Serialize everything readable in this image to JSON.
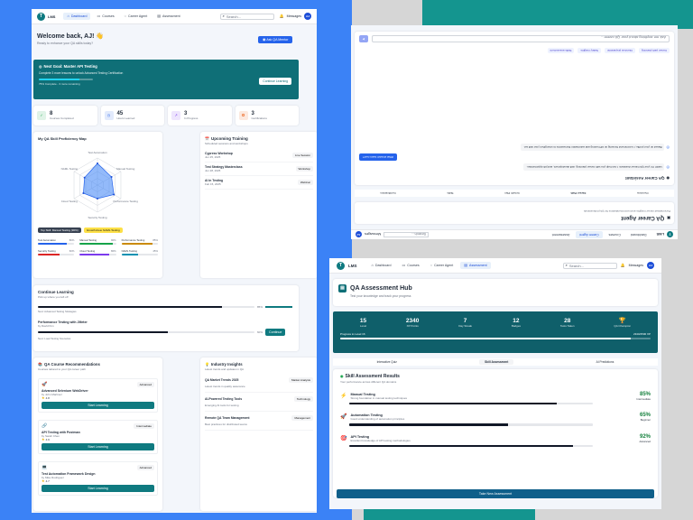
{
  "brand": {
    "name": "LMS",
    "logo": "T"
  },
  "nav": {
    "dashboard": "Dashboard",
    "courses": "Courses",
    "career_agent": "Career Agent",
    "assessment": "Assessment",
    "search_placeholder": "Search...",
    "messages": "Messages",
    "avatar": "AJ"
  },
  "dashboard": {
    "welcome": "Welcome back, AJ! 👋",
    "subtitle": "Ready to enhance your QA skills today?",
    "ask_button": "Ask QA Mentor",
    "banner": {
      "title": "Next Goal: Master API Testing",
      "desc": "Complete 3 more lessons to unlock Advanced Testing Certification",
      "progress_text": "75% Complete - 3 more remaining",
      "progress": 0.75,
      "button": "Continue Learning"
    },
    "stats": [
      {
        "value": "8",
        "label": "Courses Completed",
        "icon": "check-icon",
        "color": "#16a34a"
      },
      {
        "value": "45",
        "label": "Hours Learned",
        "icon": "clock-icon",
        "color": "#2563eb"
      },
      {
        "value": "3",
        "label": "In Progress",
        "icon": "trend-icon",
        "color": "#7c3aed"
      },
      {
        "value": "3",
        "label": "Certifications",
        "icon": "award-icon",
        "color": "#ea580c"
      }
    ],
    "proficiency": {
      "title": "My QA Skill Proficiency Map",
      "axes": [
        "Test Automation",
        "Manual Testing",
        "Performance Testing",
        "Security Testing",
        "Cloud Testing",
        "NAML Testing"
      ],
      "values": [
        0.8,
        0.6,
        0.7,
        0.5,
        0.6,
        0.55
      ],
      "top_skill": "Top Skill: Manual Testing (90%)",
      "growth": "Growth Area: NAML Testing",
      "skills": [
        {
          "name": "Test Automation",
          "value": "80%",
          "p": 0.8,
          "color": "#2563eb"
        },
        {
          "name": "Manual Testing",
          "value": "90%",
          "p": 0.9,
          "color": "#16a34a"
        },
        {
          "name": "Performance Testing",
          "value": "85%",
          "p": 0.85,
          "color": "#ca8a04"
        },
        {
          "name": "Security Testing",
          "value": "60%",
          "p": 0.6,
          "color": "#dc2626"
        },
        {
          "name": "Cloud Testing",
          "value": "80%",
          "p": 0.8,
          "color": "#7c3aed"
        },
        {
          "name": "NAML Testing",
          "value": "45%",
          "p": 0.45,
          "color": "#0891b2"
        }
      ]
    },
    "training": {
      "title": "Upcoming Training",
      "subtitle": "Scheduled sessions and workshops",
      "items": [
        {
          "name": "Cypress Workshop",
          "date": "Jun 25, 2025",
          "tag": "Live Session"
        },
        {
          "name": "Test Strategy Masterclass",
          "date": "Jun 28, 2025",
          "tag": "Workshop"
        },
        {
          "name": "AI in Testing",
          "date": "Feb 15, 2025",
          "tag": "Webinar"
        }
      ]
    },
    "continue": {
      "title": "Continue Learning",
      "subtitle": "Pick up where you left off",
      "items": [
        {
          "name": "",
          "meta": "Next: Advanced Testing Strategies",
          "pct": "85%",
          "p": 0.85,
          "button": ""
        },
        {
          "name": "Performance Testing with JMeter",
          "author": "by David Kim",
          "meta": "Next: Load Testing Scenarios",
          "pct": "60%",
          "p": 0.6,
          "button": "Continue"
        }
      ]
    },
    "recs": {
      "title": "QA Course Recommendations",
      "subtitle": "Courses tailored to your QA career path",
      "items": [
        {
          "icon": "rocket-icon",
          "name": "Advanced Selenium WebDriver",
          "author": "by John Martinez",
          "rating": "4.8",
          "level": "Advanced",
          "button": "Start Learning"
        },
        {
          "icon": "link-icon",
          "name": "API Testing with Postman",
          "author": "by Sarah Chen",
          "rating": "4.9",
          "level": "Intermediate",
          "button": "Start Learning"
        },
        {
          "icon": "laptop-icon",
          "name": "Test Automation Framework Design",
          "author": "by Mike Rodriguez",
          "rating": "4.7",
          "level": "Advanced",
          "button": "Start Learning"
        }
      ]
    },
    "insights": {
      "title": "Industry Insights",
      "subtitle": "Latest trends and updates in QA",
      "items": [
        {
          "name": "QA Market Trends 2025",
          "desc": "Latest trends in quality assurance",
          "tag": "Market Analysis"
        },
        {
          "name": "AI-Powered Testing Tools",
          "desc": "Emerging AI tools for testing",
          "tag": "Technology"
        },
        {
          "name": "Remote QA Team Management",
          "desc": "Best practices for distributed teams",
          "tag": "Management"
        }
      ]
    }
  },
  "career": {
    "title": "QA Career Agent",
    "subtitle": "Personalized career insights and recommendations for QA professionals",
    "tabs": [
      "Overview",
      "Career Path",
      "Growth Plan",
      "Skills",
      "Certifications"
    ],
    "assistant_title": "QA Career Assistant",
    "msg_bot1": "Hello! I'm your QA Career Assistant. I can help you with career planning, skill development, and job opportunities.",
    "msg_user": "What should I learn next?",
    "msg_bot2": "Based on your profile, I recommend focusing on API testing and automation frameworks to strengthen your skill set.",
    "chips": [
      "Career path planning",
      "Interview preparation",
      "Salary insights",
      "Skills assessment"
    ],
    "placeholder": "Ask me anything about your QA career..."
  },
  "assessment": {
    "title": "QA Assessment Hub",
    "subtitle": "Test your knowledge and track your progress",
    "stats": [
      {
        "value": "15",
        "label": "Level"
      },
      {
        "value": "2340",
        "label": "XP Points"
      },
      {
        "value": "7",
        "label": "Day Streak"
      },
      {
        "value": "12",
        "label": "Badges"
      },
      {
        "value": "28",
        "label": "Tests Taken"
      },
      {
        "value": "🏆",
        "label": "QA Champion"
      }
    ],
    "level_label": "Progress to Level 16",
    "level_xp": "2340/2500 XP",
    "level_progress": 0.936,
    "tabs": [
      "Interactive Quiz",
      "Skill Assessment",
      "AI Predictions"
    ],
    "results_title": "Skill Assessment Results",
    "results_sub": "Your performance across different QA domains",
    "skills": [
      {
        "icon": "zap-icon",
        "name": "Manual Testing",
        "desc": "Strong foundation in manual testing techniques",
        "pct": "85%",
        "p": 0.85,
        "level": "Intermediate"
      },
      {
        "icon": "rocket-icon",
        "name": "Automation Testing",
        "desc": "Good understanding of automation principles",
        "pct": "65%",
        "p": 0.65,
        "level": "Beginner"
      },
      {
        "icon": "target-icon",
        "name": "API Testing",
        "desc": "Excellent knowledge of API testing methodologies",
        "pct": "92%",
        "p": 0.92,
        "level": "Advanced"
      }
    ],
    "button": "Take New Assessment"
  }
}
